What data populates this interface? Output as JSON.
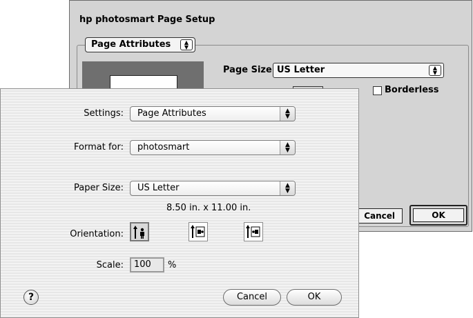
{
  "back_dialog": {
    "title": "hp photosmart Page Setup",
    "attributes_popup": "Page Attributes",
    "page_size_label": "Page Size:",
    "page_size_value": "US Letter",
    "borderless_label": "Borderless",
    "borderless_checked": false,
    "cancel_label": "Cancel",
    "ok_label": "OK"
  },
  "front_dialog": {
    "settings_label": "Settings:",
    "settings_value": "Page Attributes",
    "format_label": "Format for:",
    "format_value": "photosmart",
    "paper_label": "Paper Size:",
    "paper_value": "US Letter",
    "paper_dimensions": "8.50 in. x 11.00 in.",
    "orientation_label": "Orientation:",
    "orientation_options": [
      "portrait-icon",
      "landscape-left-icon",
      "landscape-right-icon"
    ],
    "orientation_selected": 0,
    "scale_label": "Scale:",
    "scale_value": "100",
    "scale_unit": "%",
    "help_label": "?",
    "cancel_label": "Cancel",
    "ok_label": "OK"
  }
}
